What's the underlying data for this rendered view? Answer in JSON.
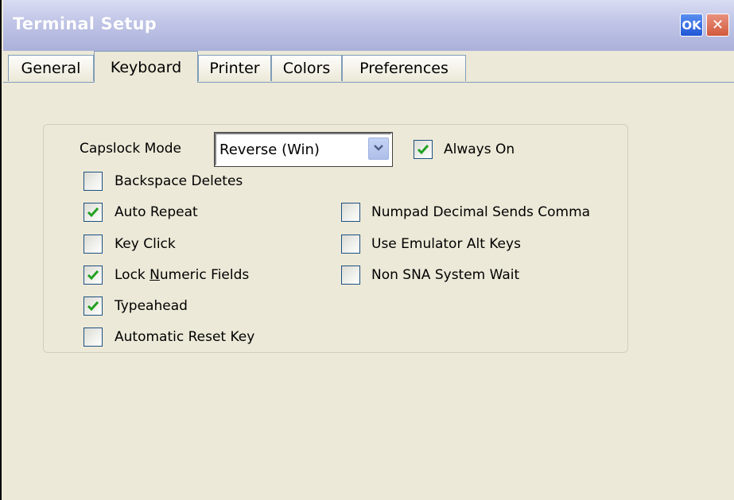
{
  "window": {
    "title": "Terminal Setup",
    "ok_label": "OK",
    "close_label": "✕"
  },
  "tabs": [
    {
      "label": "General",
      "active": false
    },
    {
      "label": "Keyboard",
      "active": true
    },
    {
      "label": "Printer",
      "active": false
    },
    {
      "label": "Colors",
      "active": false
    },
    {
      "label": "Preferences",
      "active": false
    }
  ],
  "keyboard": {
    "capslock_mode_label": "Capslock Mode",
    "capslock_mode_value": "Reverse (Win)",
    "always_on": {
      "label": "Always On",
      "checked": true
    },
    "backspace_deletes": {
      "label": "Backspace Deletes",
      "checked": false
    },
    "auto_repeat": {
      "label": "Auto Repeat",
      "checked": true
    },
    "key_click": {
      "label": "Key Click",
      "checked": false
    },
    "lock_numeric_fields": {
      "label_pre": "Lock ",
      "label_u": "N",
      "label_post": "umeric Fields",
      "checked": true
    },
    "typeahead": {
      "label": "Typeahead",
      "checked": true
    },
    "automatic_reset_key": {
      "label": "Automatic Reset Key",
      "checked": false
    },
    "numpad_decimal_sends_comma": {
      "label": "Numpad Decimal Sends Comma",
      "checked": false
    },
    "use_emulator_alt_keys": {
      "label": "Use Emulator Alt Keys",
      "checked": false
    },
    "non_sna_system_wait": {
      "label": "Non SNA System Wait",
      "checked": false
    }
  },
  "colors": {
    "checkmark": "#21a121",
    "checkbox_border": "#1c5180",
    "titlebar_text": "#ffffff"
  }
}
